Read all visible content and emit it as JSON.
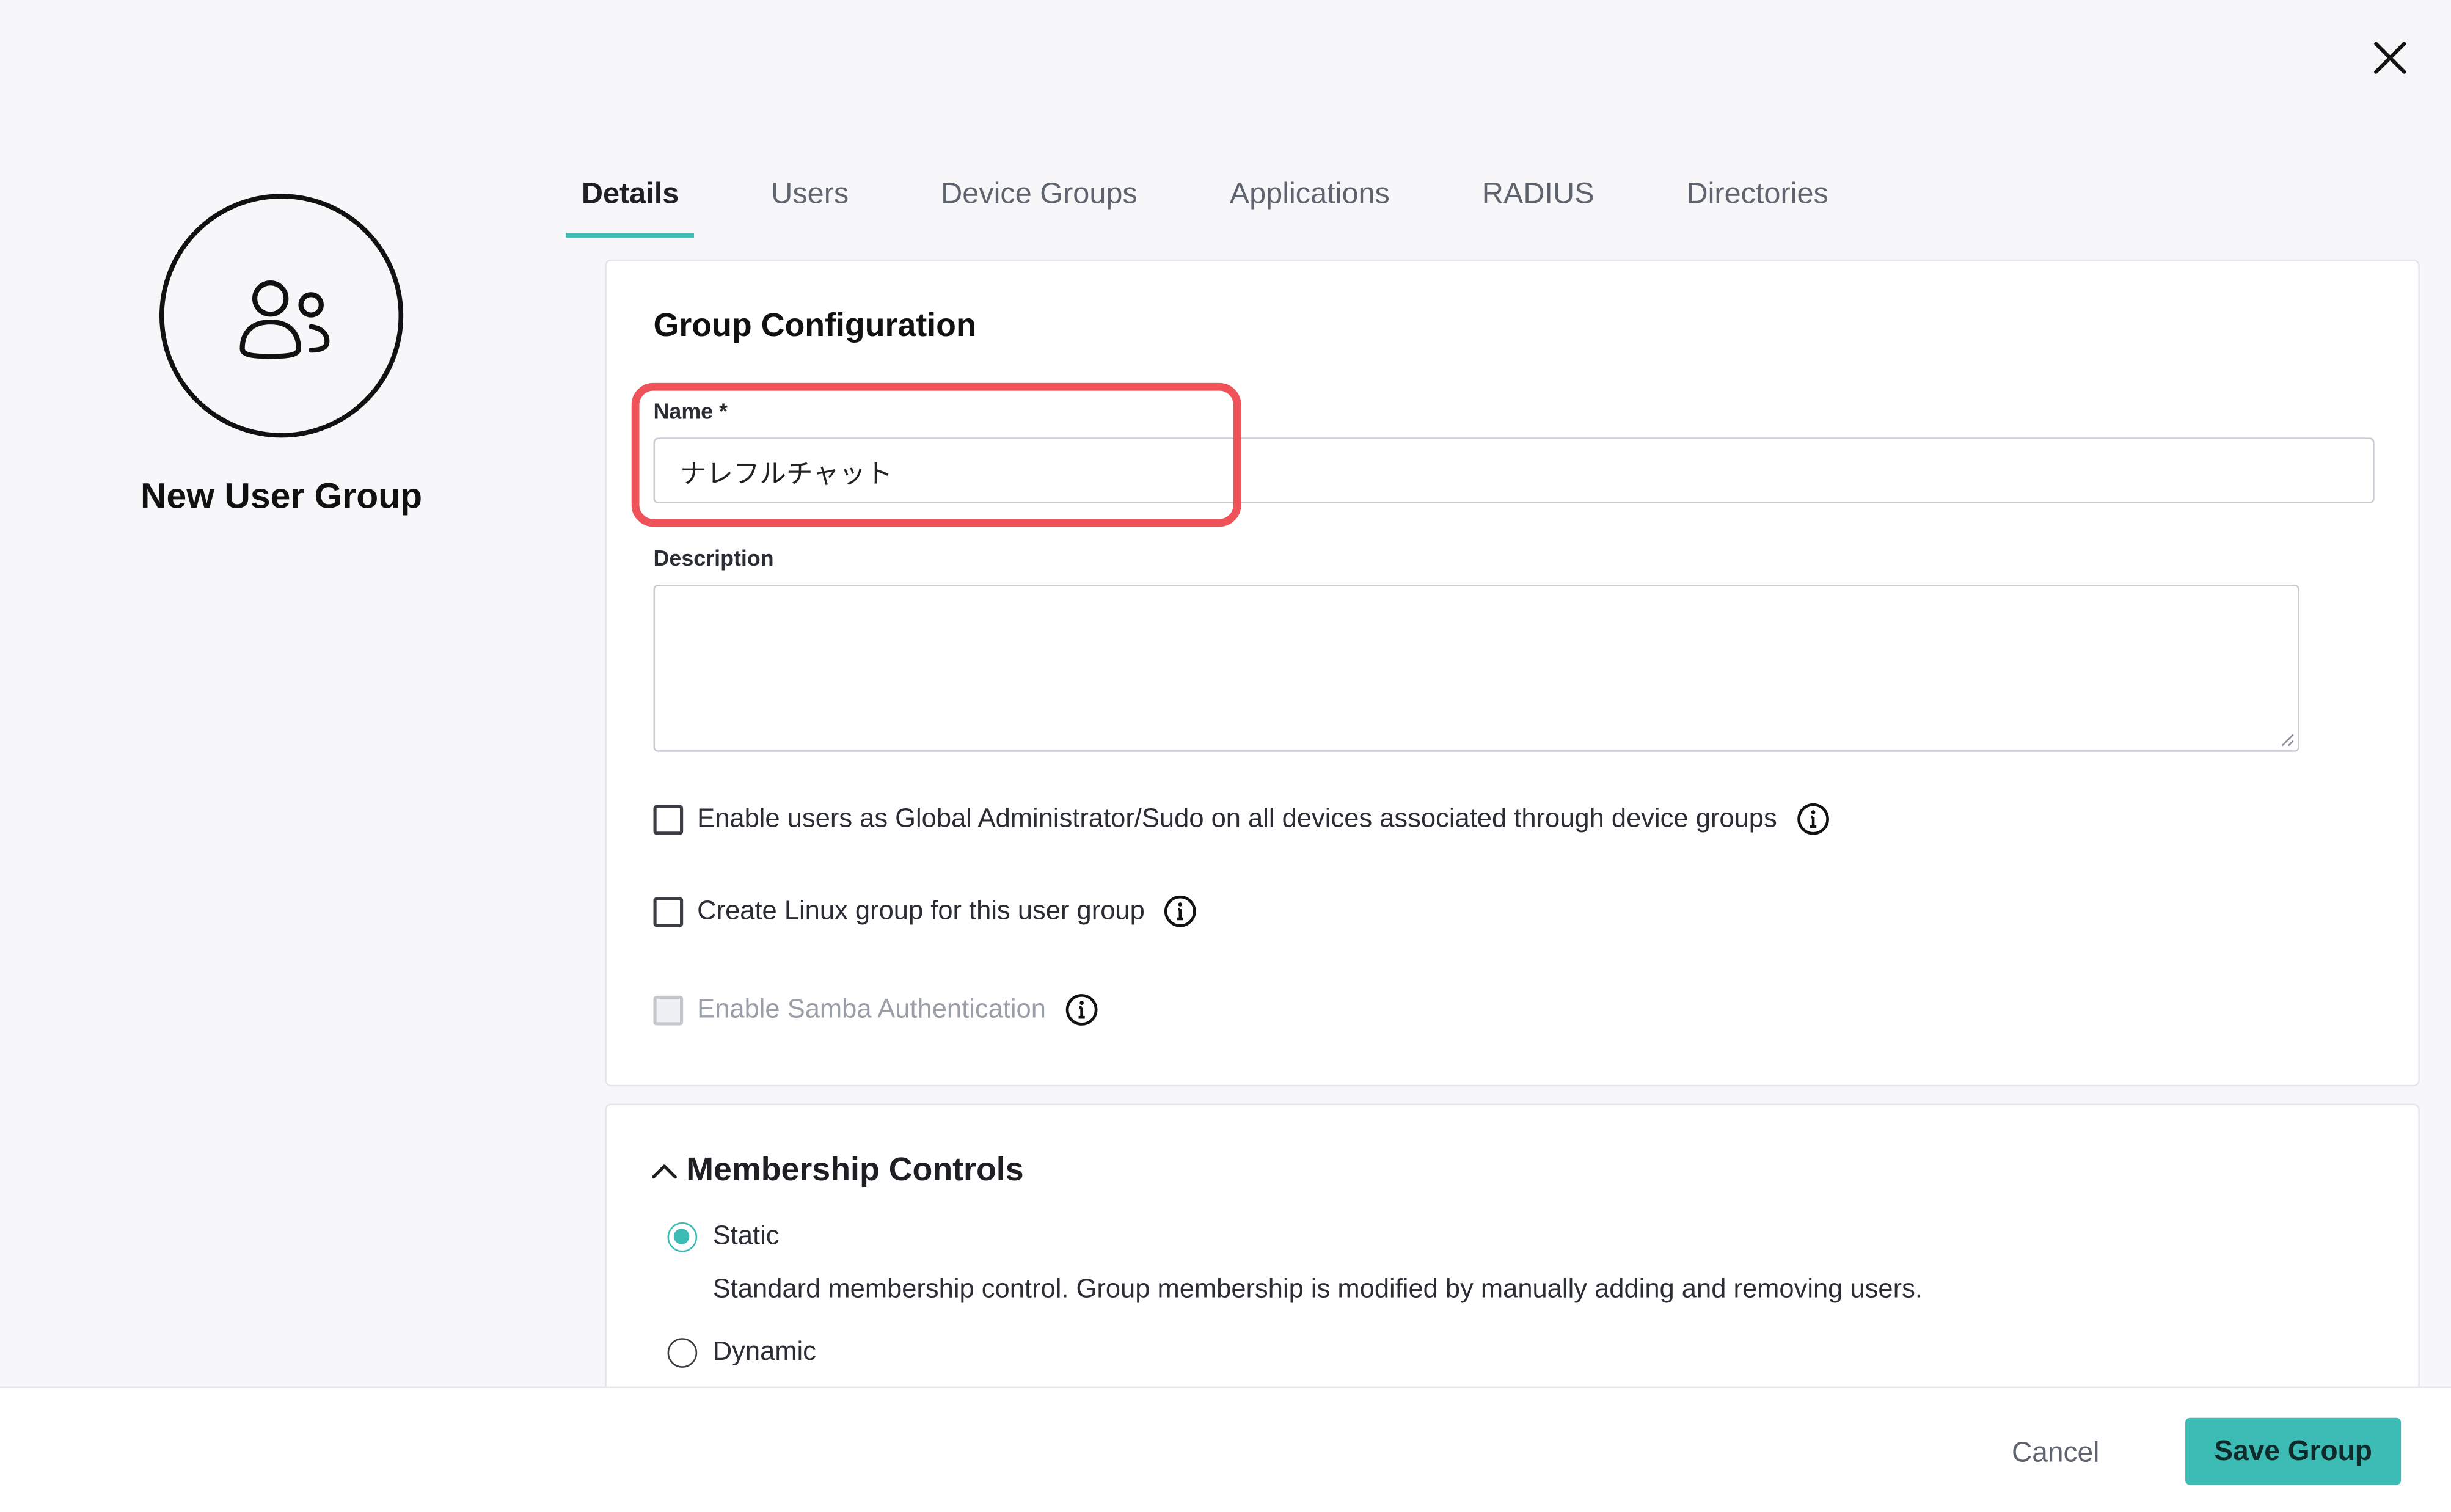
{
  "dialog": {
    "close_icon": "close-icon"
  },
  "group": {
    "title": "New User Group",
    "avatar_icon": "users-icon"
  },
  "tabs": [
    {
      "label": "Details",
      "active": true
    },
    {
      "label": "Users"
    },
    {
      "label": "Device Groups"
    },
    {
      "label": "Applications"
    },
    {
      "label": "RADIUS"
    },
    {
      "label": "Directories"
    }
  ],
  "config": {
    "heading": "Group Configuration",
    "name_label": "Name *",
    "name_value": "ナレフルチャット",
    "description_label": "Description",
    "description_value": "",
    "options": [
      {
        "label": "Enable users as Global Administrator/Sudo on all devices associated through device groups",
        "checked": false,
        "disabled": false
      },
      {
        "label": "Create Linux group for this user group",
        "checked": false,
        "disabled": false
      },
      {
        "label": "Enable Samba Authentication",
        "checked": false,
        "disabled": true
      }
    ]
  },
  "membership": {
    "heading": "Membership Controls",
    "static_label": "Static",
    "static_description": "Standard membership control. Group membership is modified by manually adding and removing users.",
    "dynamic_label": "Dynamic",
    "selected": "Static"
  },
  "footer": {
    "cancel_label": "Cancel",
    "save_label": "Save Group"
  },
  "colors": {
    "accent": "#3cbcb4",
    "highlight": "#f0525a",
    "background": "#f7f7fa"
  }
}
